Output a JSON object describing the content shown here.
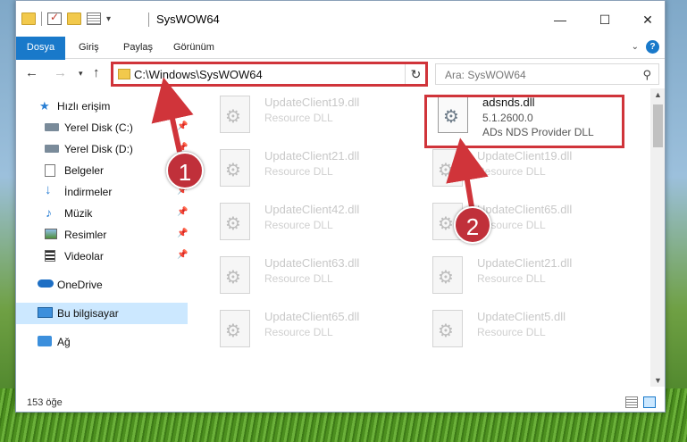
{
  "window": {
    "title": "SysWOW64",
    "controls": {
      "minimize": "—",
      "maximize": "☐",
      "close": "✕"
    }
  },
  "ribbon": {
    "tabs": [
      "Dosya",
      "Giriş",
      "Paylaş",
      "Görünüm"
    ],
    "expand_icon": "⌄",
    "help_icon": "?"
  },
  "navbar": {
    "back": "←",
    "forward": "→",
    "recent": "▾",
    "up": "↑",
    "address": "C:\\Windows\\SysWOW64",
    "refresh": "↻",
    "search_placeholder": "Ara: SysWOW64",
    "search_icon": "⚲"
  },
  "sidebar": {
    "items": [
      {
        "label": "Hızlı erişim",
        "icon": "star-icon",
        "pinned": false
      },
      {
        "label": "Yerel Disk (C:)",
        "icon": "drive-icon",
        "pinned": true
      },
      {
        "label": "Yerel Disk (D:)",
        "icon": "drive-icon",
        "pinned": true
      },
      {
        "label": "Belgeler",
        "icon": "documents-icon",
        "pinned": true
      },
      {
        "label": "İndirmeler",
        "icon": "download-icon",
        "pinned": true
      },
      {
        "label": "Müzik",
        "icon": "music-icon",
        "pinned": true
      },
      {
        "label": "Resimler",
        "icon": "pictures-icon",
        "pinned": true
      },
      {
        "label": "Videolar",
        "icon": "videos-icon",
        "pinned": true
      },
      {
        "label": "OneDrive",
        "icon": "cloud-icon",
        "pinned": false
      },
      {
        "label": "Bu bilgisayar",
        "icon": "computer-icon",
        "pinned": false,
        "selected": true
      },
      {
        "label": "Ağ",
        "icon": "network-icon",
        "pinned": false
      }
    ],
    "pin_glyph": "📌"
  },
  "files": {
    "left_column": [
      {
        "name": "UpdateClient19.dll",
        "type": "Resource DLL"
      },
      {
        "name": "UpdateClient21.dll",
        "type": "Resource DLL"
      },
      {
        "name": "UpdateClient42.dll",
        "type": "Resource DLL"
      },
      {
        "name": "UpdateClient63.dll",
        "type": "Resource DLL"
      },
      {
        "name": "UpdateClient65.dll",
        "type": "Resource DLL"
      }
    ],
    "right_column": [
      {
        "name": "adsnds.dll",
        "version": "5.1.2600.0",
        "type": "ADs NDS Provider DLL",
        "active": true
      },
      {
        "name": "UpdateClient19.dll",
        "type": "Resource DLL"
      },
      {
        "name": "UpdateClient65.dll",
        "type": "Resource DLL"
      },
      {
        "name": "UpdateClient21.dll",
        "type": "Resource DLL"
      },
      {
        "name": "UpdateClient5.dll",
        "type": "Resource DLL"
      }
    ]
  },
  "status": {
    "count": "153 öğe"
  },
  "annotations": {
    "step1": "1",
    "step2": "2",
    "highlight_color": "#d0343a"
  }
}
